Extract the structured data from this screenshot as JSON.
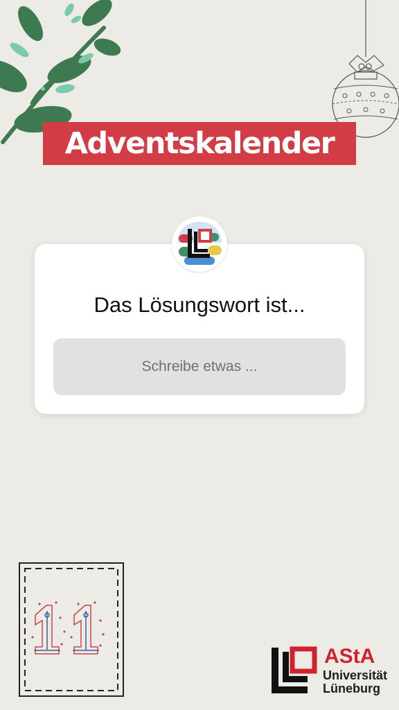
{
  "header": {
    "title": "Adventskalender"
  },
  "question_card": {
    "question": "Das Lösungswort ist...",
    "input_placeholder": "Schreibe etwas ...",
    "input_value": ""
  },
  "calendar_door": {
    "number": "11"
  },
  "footer_logo": {
    "name": "AStA",
    "line1": "Universität",
    "line2": "Lüneburg"
  },
  "colors": {
    "background": "#ecebe5",
    "banner": "#d23c44",
    "card": "#ffffff",
    "input_bg": "#e1e1e1",
    "leaf_dark": "#3e7a4f",
    "leaf_light": "#7ccaae",
    "logo_red": "#d0222e"
  },
  "icons": {
    "branch": "holly-branch-icon",
    "ornament": "christmas-bauble-icon",
    "avatar": "asta-profile-avatar",
    "door": "advent-door-number-icon"
  }
}
